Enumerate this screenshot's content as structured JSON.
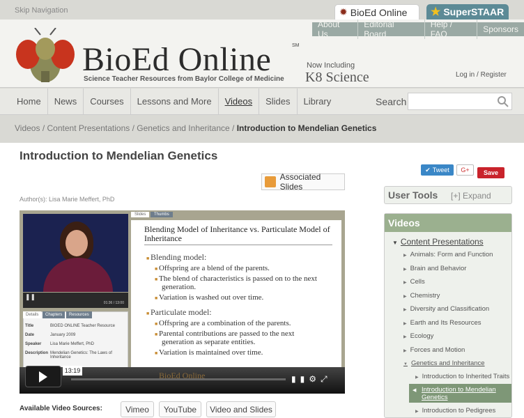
{
  "skip_nav": "Skip Navigation",
  "site_tabs": {
    "bioed": "BioEd Online",
    "superstaar": "SuperSTAAR"
  },
  "top_nav": [
    "About Us",
    "Editorial Board",
    "Help / FAQ",
    "Sponsors"
  ],
  "logo": {
    "title": "BioEd Online",
    "sm": "SM",
    "tagline": "Science Teacher Resources from Baylor College of Medicine"
  },
  "k8": {
    "now": "Now Including",
    "name": "K8 Science"
  },
  "account": {
    "login": "Log in",
    "sep": "/",
    "register": "Register"
  },
  "main_nav": [
    "Home",
    "News",
    "Courses",
    "Lessons and More",
    "Videos",
    "Slides",
    "Library"
  ],
  "search": {
    "label": "Search",
    "placeholder": ""
  },
  "breadcrumb": {
    "items": [
      "Videos",
      "Content Presentations",
      "Genetics and Inheritance"
    ],
    "current": "Introduction to Mendelian Genetics"
  },
  "page_title": "Introduction to Mendelian Genetics",
  "share": {
    "tweet": "Tweet",
    "gplus": "G+",
    "save": "Save"
  },
  "associated_slides": "Associated Slides",
  "author": "Author(s): Lisa Marie Meffert, PhD",
  "player": {
    "video_time": "01:36 / 13:00",
    "detail_tabs": [
      "Details",
      "Chapters",
      "Resources"
    ],
    "details": [
      {
        "k": "Title",
        "v": "BIOED ONLINE Teacher Resource"
      },
      {
        "k": "Date",
        "v": "January 2009"
      },
      {
        "k": "Speaker",
        "v": "Lisa Marie Meffert, PhD"
      },
      {
        "k": "Description",
        "v": "Mendelian Genetics: The Laws of Inheritance"
      }
    ],
    "slide_tabs": [
      "Slides",
      "Thumbs"
    ],
    "slide": {
      "title": "Blending Model of Inheritance vs. Particulate Model of Inheritance",
      "h1": "Blending model:",
      "b1": [
        "Offspring are a blend of the parents.",
        "The blend of characteristics is passed on to the next",
        "generation.",
        "Variation is washed out over time."
      ],
      "h2": "Particulate model:",
      "b2": [
        "Offspring are a combination of the parents.",
        "Parental contributions are passed to the  next",
        "generation as separate entities.",
        "Variation is maintained over time."
      ]
    },
    "time": "13:19",
    "watermark": "BioEd Online"
  },
  "sources": {
    "label": "Available Video Sources:",
    "buttons": [
      "Vimeo",
      "YouTube",
      "Video and Slides"
    ]
  },
  "user_tools": {
    "label": "User Tools",
    "expand": "[+] Expand"
  },
  "videos_nav": {
    "heading": "Videos",
    "section": "Content Presentations",
    "items": [
      "Animals: Form and Function",
      "Brain and Behavior",
      "Cells",
      "Chemistry",
      "Diversity and Classification",
      "Earth and Its Resources",
      "Ecology",
      "Forces and Motion",
      "Genetics and Inheritance"
    ],
    "sub_items": [
      "Introduction to Inherited Traits",
      "Introduction to Mendelian Genetics",
      "Introduction to Pedigrees"
    ]
  }
}
